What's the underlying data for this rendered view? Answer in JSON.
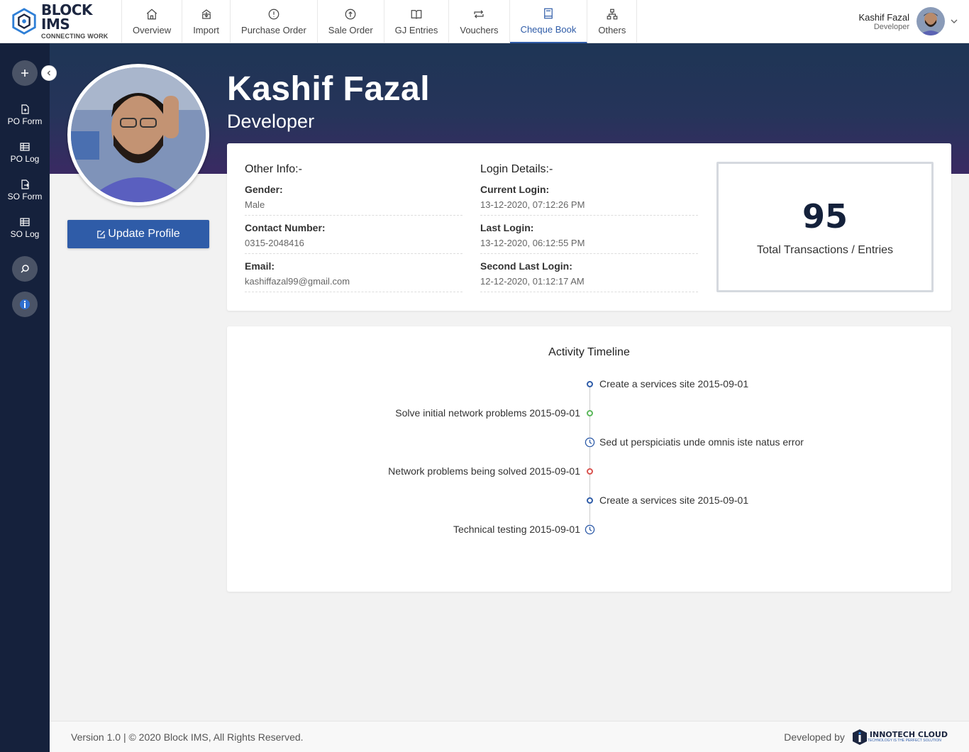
{
  "brand": {
    "name": "BLOCK IMS",
    "tagline": "CONNECTING WORK"
  },
  "nav": [
    {
      "label": "Overview",
      "icon": "home-icon"
    },
    {
      "label": "Import",
      "icon": "import-icon"
    },
    {
      "label": "Purchase Order",
      "icon": "purchase-order-icon"
    },
    {
      "label": "Sale Order",
      "icon": "sale-order-icon"
    },
    {
      "label": "GJ Entries",
      "icon": "book-open-icon"
    },
    {
      "label": "Vouchers",
      "icon": "repeat-icon"
    },
    {
      "label": "Cheque Book",
      "icon": "cheque-book-icon",
      "active": true
    },
    {
      "label": "Others",
      "icon": "sitemap-icon"
    }
  ],
  "user": {
    "name": "Kashif Fazal",
    "role": "Developer"
  },
  "sidebar": [
    {
      "label": "PO Form",
      "icon": "file-plus-icon"
    },
    {
      "label": "PO Log",
      "icon": "table-icon"
    },
    {
      "label": "SO Form",
      "icon": "file-export-icon"
    },
    {
      "label": "SO Log",
      "icon": "table-icon"
    }
  ],
  "profile": {
    "name": "Kashif Fazal",
    "role": "Developer",
    "update_label": "Update Profile"
  },
  "other_info": {
    "heading": "Other Info:-",
    "fields": [
      {
        "label": "Gender:",
        "value": "Male"
      },
      {
        "label": "Contact Number:",
        "value": "0315-2048416"
      },
      {
        "label": "Email:",
        "value": "kashiffazal99@gmail.com"
      }
    ]
  },
  "login_details": {
    "heading": "Login Details:-",
    "fields": [
      {
        "label": "Current Login:",
        "value": "13-12-2020, 07:12:26 PM"
      },
      {
        "label": "Last Login:",
        "value": "13-12-2020, 06:12:55 PM"
      },
      {
        "label": "Second Last Login:",
        "value": "12-12-2020, 01:12:17 AM"
      }
    ]
  },
  "stats": {
    "value": "95",
    "label": "Total Transactions / Entries"
  },
  "timeline": {
    "title": "Activity Timeline",
    "items": [
      {
        "text": "Create a services site 2015-09-01",
        "side": "right",
        "marker": "dot",
        "color": "#2f5ca8"
      },
      {
        "text": "Solve initial network problems 2015-09-01",
        "side": "left",
        "marker": "dot",
        "color": "#5cb85c"
      },
      {
        "text": "Sed ut perspiciatis unde omnis iste natus error",
        "side": "right",
        "marker": "clock",
        "color": "#2f5ca8"
      },
      {
        "text": "Network problems being solved 2015-09-01",
        "side": "left",
        "marker": "dot",
        "color": "#d9534f"
      },
      {
        "text": "Create a services site 2015-09-01",
        "side": "right",
        "marker": "dot",
        "color": "#2f5ca8"
      },
      {
        "text": "Technical testing 2015-09-01",
        "side": "left",
        "marker": "clock",
        "color": "#2f5ca8"
      }
    ]
  },
  "footer": {
    "copyright": "Version 1.0 | © 2020 Block IMS, All Rights Reserved.",
    "developed_by": "Developed by",
    "company": "INNOTECH CLOUD",
    "company_tagline": "TECHNOLOGY IS THE PERFECT SOLUTION"
  }
}
